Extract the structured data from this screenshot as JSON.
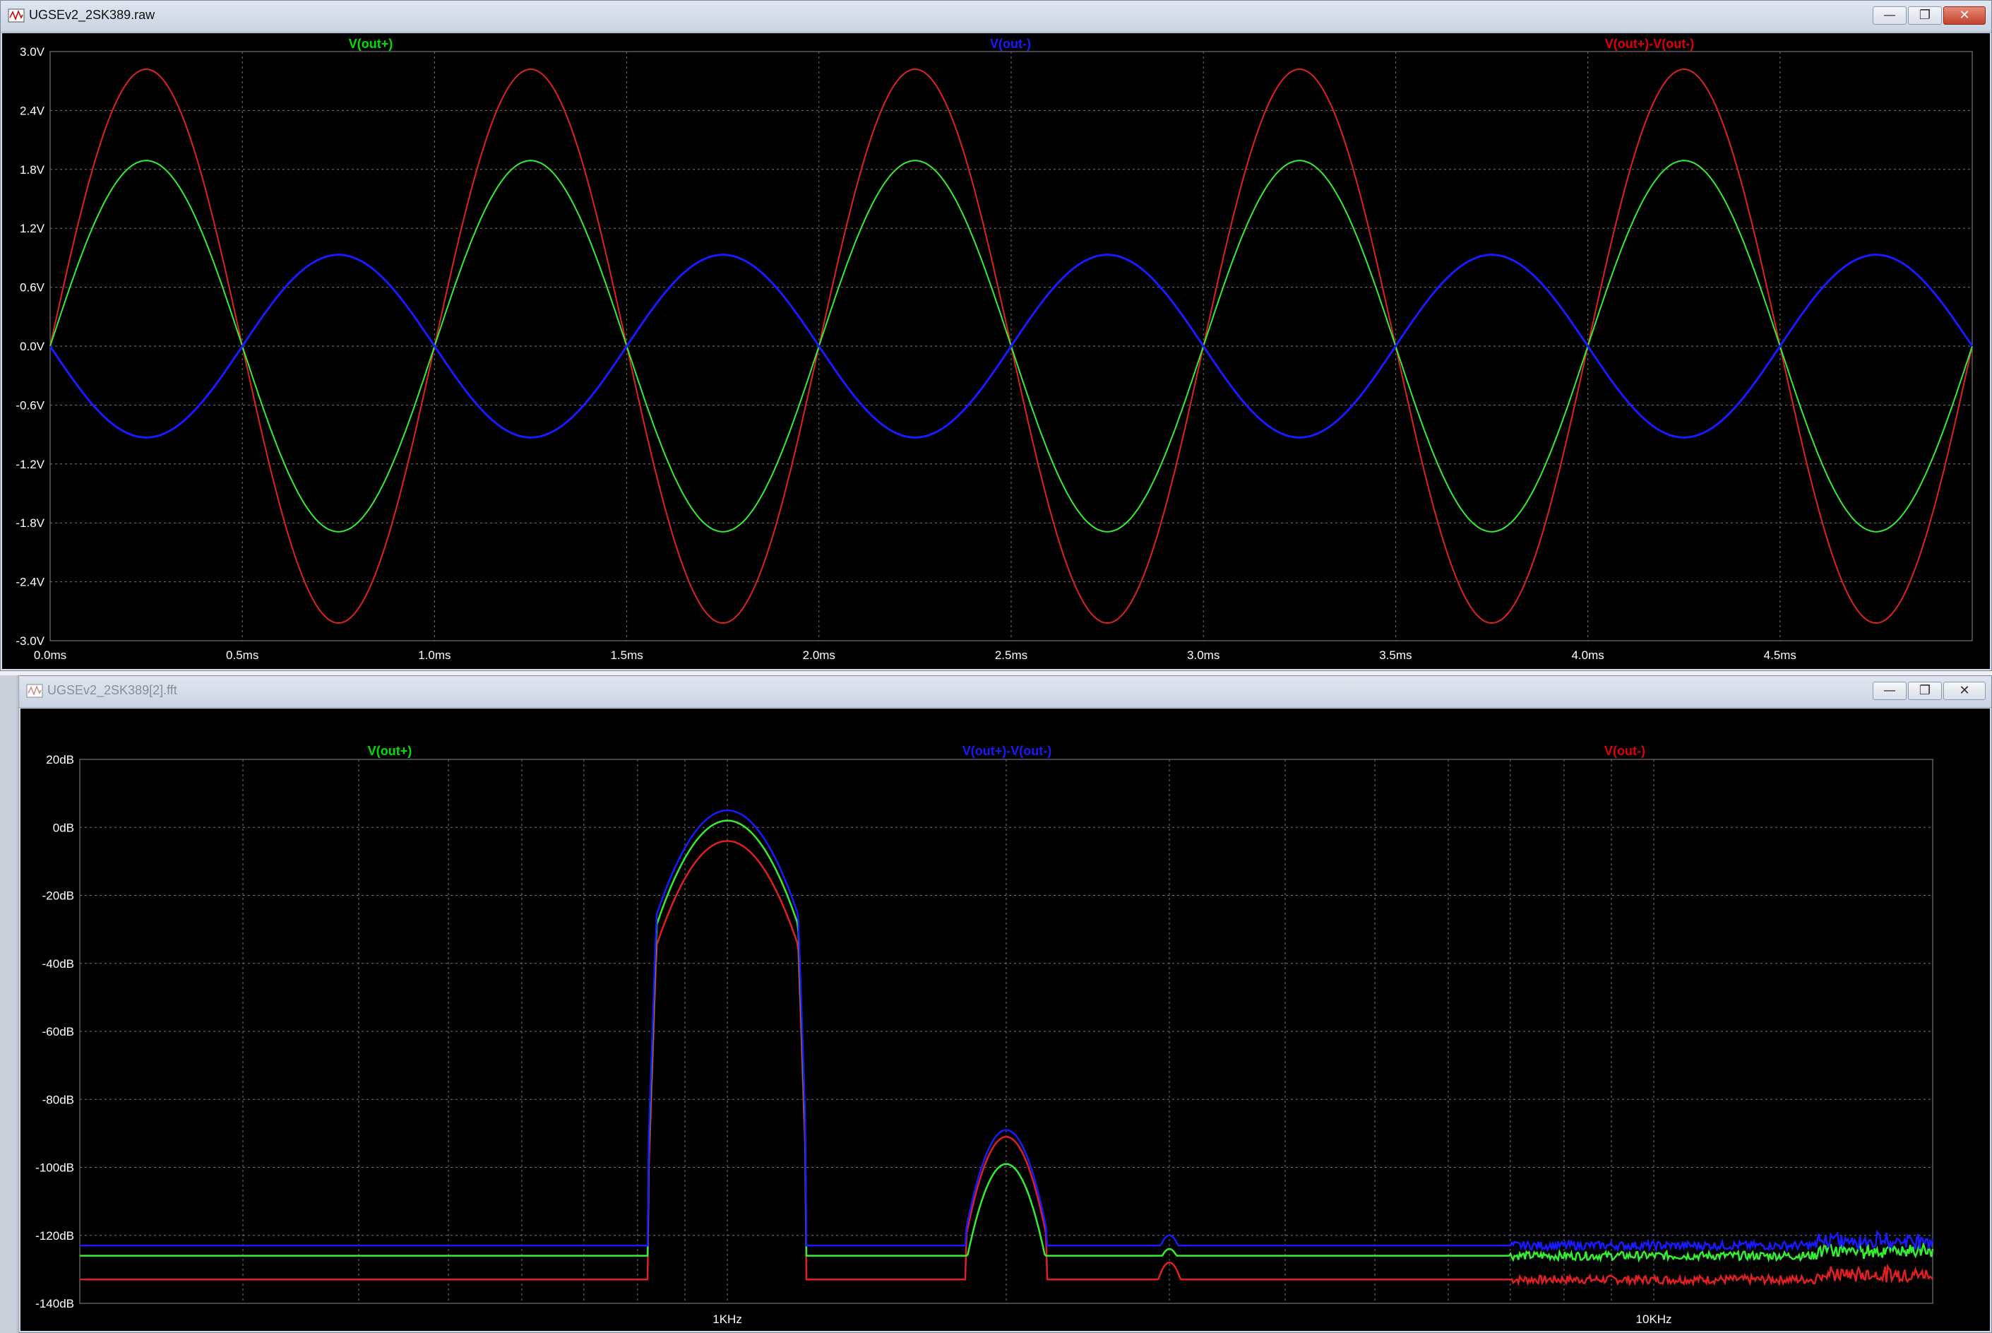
{
  "top_window": {
    "title": "UGSEv2_2SK389.raw",
    "icon": "waveform-icon",
    "active": true,
    "chart_data": {
      "type": "line",
      "title": "",
      "xlabel": "",
      "ylabel": "",
      "x_ticks": [
        "0.0ms",
        "0.5ms",
        "1.0ms",
        "1.5ms",
        "2.0ms",
        "2.5ms",
        "3.0ms",
        "3.5ms",
        "4.0ms",
        "4.5ms"
      ],
      "y_ticks": [
        "3.0V",
        "2.4V",
        "1.8V",
        "1.2V",
        "0.6V",
        "0.0V",
        "-0.6V",
        "-1.2V",
        "-1.8V",
        "-2.4V",
        "-3.0V"
      ],
      "xlim_ms": [
        0,
        5
      ],
      "ylim_v": [
        -3.0,
        3.0
      ],
      "grid": true,
      "legend": [
        {
          "label": "V(out+)",
          "color": "#00e000"
        },
        {
          "label": "V(out-)",
          "color": "#1a1aff"
        },
        {
          "label": "V(out+)-V(out-)",
          "color": "#e00000"
        }
      ],
      "series": [
        {
          "name": "V(out+)",
          "color": "#33ee33",
          "waveform": "sine",
          "frequency_khz": 1.0,
          "amplitude_v": 1.89,
          "phase": 0
        },
        {
          "name": "V(out-)",
          "color": "#1a1aff",
          "waveform": "sine",
          "frequency_khz": 1.0,
          "amplitude_v": 0.93,
          "phase": 180
        },
        {
          "name": "V(out+)-V(out-)",
          "color": "#dd2222",
          "waveform": "sine",
          "frequency_khz": 1.0,
          "amplitude_v": 2.82,
          "phase": 0
        }
      ]
    }
  },
  "bottom_window": {
    "title": "UGSEv2_2SK389[2].fft",
    "icon": "waveform-icon",
    "active": false,
    "chart_data": {
      "type": "line",
      "title": "",
      "xlabel": "",
      "ylabel": "",
      "x_scale": "log",
      "x_ticks": [
        "1KHz",
        "10KHz"
      ],
      "y_ticks": [
        "20dB",
        "0dB",
        "-20dB",
        "-40dB",
        "-60dB",
        "-80dB",
        "-100dB",
        "-120dB",
        "-140dB"
      ],
      "xlim_hz": [
        200,
        20000
      ],
      "ylim_db": [
        -140,
        20
      ],
      "grid": true,
      "legend": [
        {
          "label": "V(out+)",
          "color": "#00e000"
        },
        {
          "label": "V(out+)-V(out-)",
          "color": "#1a1aff"
        },
        {
          "label": "V(out-)",
          "color": "#e00000"
        }
      ],
      "series": [
        {
          "name": "V(out+)-V(out-)",
          "color": "#1a1aff",
          "noise_floor_db": -123,
          "fundamental_hz": 1000,
          "fundamental_db": 5,
          "harmonic2_hz": 2000,
          "harmonic2_db": -89,
          "harmonic3_hz": 3000,
          "harmonic3_db": -120
        },
        {
          "name": "V(out+)",
          "color": "#33ee33",
          "noise_floor_db": -126,
          "fundamental_hz": 1000,
          "fundamental_db": 2,
          "harmonic2_hz": 2000,
          "harmonic2_db": -99,
          "harmonic3_hz": 3000,
          "harmonic3_db": -124
        },
        {
          "name": "V(out-)",
          "color": "#e02020",
          "noise_floor_db": -133,
          "fundamental_hz": 1000,
          "fundamental_db": -4,
          "harmonic2_hz": 2000,
          "harmonic2_db": -91,
          "harmonic3_hz": 3000,
          "harmonic3_db": -128
        }
      ]
    }
  }
}
